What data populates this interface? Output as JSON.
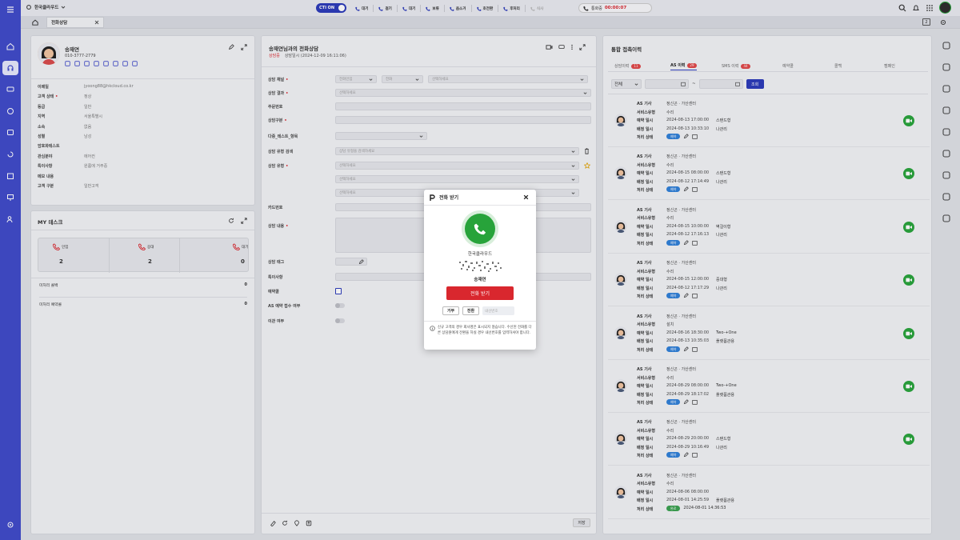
{
  "app": {
    "company": "한국클라우드",
    "cti_label": "CTI ON",
    "state_label": "통화중",
    "timer": "00:00:07"
  },
  "topbar": {
    "items": [
      {
        "label": "대기"
      },
      {
        "label": "걸기"
      },
      {
        "label": "대기"
      },
      {
        "label": "보류"
      },
      {
        "label": "음소거"
      },
      {
        "label": "호전환"
      },
      {
        "label": "후처리"
      },
      {
        "label": "식사"
      }
    ]
  },
  "tabs": [
    {
      "label": "전화상담"
    }
  ],
  "customer": {
    "name": "송재연",
    "phone": "010-3777-2779",
    "fields": [
      {
        "label": "이메일",
        "value": "jyoong88@hkcloud.co.kr"
      },
      {
        "label": "고객 상태",
        "value": "정상",
        "required": true
      },
      {
        "label": "등급",
        "value": "일반"
      },
      {
        "label": "지역",
        "value": "서울특별시"
      },
      {
        "label": "소속",
        "value": "없음"
      },
      {
        "label": "성별",
        "value": "남성"
      },
      {
        "label": "암호화테스트",
        "value": ""
      },
      {
        "label": "관심분야",
        "value": "에어컨"
      },
      {
        "label": "특이사항",
        "value": "원룸에 거주중"
      },
      {
        "label": "메모 내용",
        "value": ""
      },
      {
        "label": "고객 구분",
        "value": "일반고객"
      }
    ]
  },
  "mydesk": {
    "title": "MY 데스크",
    "stats": [
      {
        "label": "인입",
        "value": "2"
      },
      {
        "label": "응대",
        "value": "2"
      },
      {
        "label": "대기",
        "value": "0"
      }
    ],
    "rows": [
      {
        "label": "미처리 콜백",
        "value": "0"
      },
      {
        "label": "미처리 예약콜",
        "value": "0"
      }
    ]
  },
  "consult": {
    "title": "송재연님과의 전화상담",
    "status": "상담중",
    "start": "상담일시 (2024-12-09 16:11:06)",
    "fields": [
      {
        "label": "상담 채널",
        "required": true,
        "inputs": [
          "전화인입",
          "전화",
          "선택하세요"
        ]
      },
      {
        "label": "상담 결과",
        "required": true,
        "inputs": [
          "선택하세요"
        ]
      },
      {
        "label": "주문번호",
        "inputs": [
          ""
        ]
      },
      {
        "label": "상담구분",
        "required": true,
        "inputs": [
          ""
        ]
      },
      {
        "label": "다중_테스트_항목",
        "inputs": [
          ""
        ]
      },
      {
        "label": "상담 유형 검색",
        "inputs": [
          "상담 유형을 검색하세요"
        ]
      },
      {
        "label": "상담 유형",
        "required": true,
        "inputs": [
          "선택하세요"
        ]
      },
      {
        "label": "",
        "inputs": [
          "선택하세요"
        ]
      },
      {
        "label": "",
        "inputs": [
          "선택하세요"
        ]
      },
      {
        "label": "카드번호",
        "inputs": [
          ""
        ]
      },
      {
        "label": "상담 내용",
        "required": true,
        "inputs": [
          ""
        ]
      },
      {
        "label": "상담 태그",
        "inputs": [
          ""
        ]
      },
      {
        "label": "특이사항",
        "inputs": [
          ""
        ]
      },
      {
        "label": "예약콜",
        "inputs": []
      },
      {
        "label": "AS 예약 접수 여부",
        "inputs": []
      },
      {
        "label": "이관 여부",
        "inputs": []
      }
    ],
    "save_label": "저장"
  },
  "history": {
    "title": "통합 접촉이력",
    "tabs": [
      {
        "label": "상담이력",
        "badge": "11"
      },
      {
        "label": "AS 이력",
        "badge": "29"
      },
      {
        "label": "SMS 이력",
        "badge": "44"
      },
      {
        "label": "예약콜"
      },
      {
        "label": "콜백"
      },
      {
        "label": "캠페인"
      }
    ],
    "filter": {
      "select": "전체",
      "separator": "~",
      "search": "조회"
    },
    "labels": {
      "engineer": "AS 기사",
      "service": "서비스유형",
      "reserve": "예약 일시",
      "assign": "배정 일시",
      "status": "처리 상태"
    },
    "items": [
      {
        "engineer": "정신곤 · 가산센터",
        "service": "수리",
        "reserve": "2024-08-13 17:00:00",
        "reserve_item": "스탠드형",
        "assign": "2024-08-13 10:33:10",
        "assign_item": "나관리",
        "tag": "예약",
        "tag_color": "#2f7fd8"
      },
      {
        "engineer": "정신곤 · 가산센터",
        "service": "수리",
        "reserve": "2024-08-15 08:00:00",
        "reserve_item": "스탠드형",
        "assign": "2024-08-12 17:14:49",
        "assign_item": "나관리",
        "tag": "예약",
        "tag_color": "#2f7fd8"
      },
      {
        "engineer": "정신곤 · 가산센터",
        "service": "수리",
        "reserve": "2024-08-15 10:00:00",
        "reserve_item": "벽걸이형",
        "assign": "2024-08-12 17:16:13",
        "assign_item": "나관리",
        "tag": "예약",
        "tag_color": "#2f7fd8"
      },
      {
        "engineer": "정신곤 · 가산센터",
        "service": "수리",
        "reserve": "2024-08-15 12:00:00",
        "reserve_item": "중대형",
        "assign": "2024-08-12 17:17:29",
        "assign_item": "나관리",
        "tag": "예약",
        "tag_color": "#2f7fd8"
      },
      {
        "engineer": "정신곤 · 가산센터",
        "service": "설치",
        "reserve": "2024-08-16 18:30:00",
        "reserve_item": "Two-+One",
        "assign": "2024-08-13 10:35:03",
        "assign_item": "플랫폼관용",
        "tag": "예약",
        "tag_color": "#2f7fd8"
      },
      {
        "engineer": "정신곤 · 가산센터",
        "service": "수리",
        "reserve": "2024-08-29 08:00:00",
        "reserve_item": "Two-+One",
        "assign": "2024-08-29 18:17:02",
        "assign_item": "플랫폼관용",
        "tag": "예약",
        "tag_color": "#2f7fd8"
      },
      {
        "engineer": "정신곤 · 가산센터",
        "service": "수리",
        "reserve": "2024-08-29 20:00:00",
        "reserve_item": "스탠드형",
        "assign": "2024-08-29 10:16:49",
        "assign_item": "나관리",
        "tag": "예약",
        "tag_color": "#2f7fd8"
      },
      {
        "engineer": "정신곤 · 가산센터",
        "service": "수리",
        "reserve": "2024-08-06 08:00:00",
        "reserve_item": "",
        "assign": "2024-08-01 14:25:59",
        "assign_item": "플랫폼관용",
        "tag": "완료",
        "tag_color": "#3aa14f",
        "tag_time": "2024-08-01 14:36:53"
      }
    ]
  },
  "modal": {
    "title": "전화 받기",
    "company": "한국클라우드",
    "caller": "송재연",
    "accept_label": "전화 받기",
    "reject_label": "거부",
    "transfer_label": "전환",
    "ext_placeholder": "내선번호",
    "notice": "신규 고객의 경우 회사명은 표시되지 않습니다. 수신된 전화를 다른 상담원에게 전환을 하실 경우 내선번호를 입력하셔야 합니다."
  },
  "colors": {
    "nav": "#3f4ac9",
    "accent": "#2b3ab8",
    "danger": "#d9272e",
    "call_green": "#27a33a"
  }
}
